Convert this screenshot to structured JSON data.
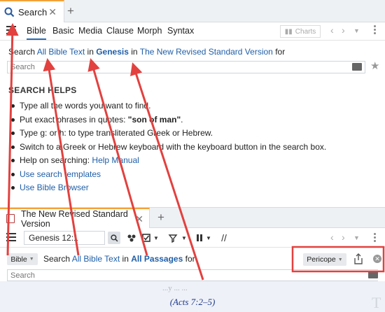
{
  "tabs": {
    "top": {
      "label": "Search",
      "icon": "search-icon",
      "close": "✕",
      "add": "+"
    },
    "bottom": {
      "label": "The New Revised Standard Version",
      "icon": "book-icon",
      "close": "✕",
      "add": "+"
    }
  },
  "menu": {
    "items": [
      "Bible",
      "Basic",
      "Media",
      "Clause",
      "Morph",
      "Syntax"
    ],
    "active": "Bible",
    "charts_label": "Charts"
  },
  "search": {
    "prefix": "Search",
    "scope": "All Bible Text",
    "in_word": "in",
    "book": "Genesis",
    "in_word2": "in",
    "version": "The New Revised Standard Version",
    "suffix": "for",
    "placeholder": "Search"
  },
  "helps": {
    "title": "SEARCH HELPS",
    "items": [
      {
        "text": "Type all the words you want to find."
      },
      {
        "text_a": "Put exact phrases in quotes: ",
        "bold": "\"son of man\"",
        "text_b": "."
      },
      {
        "text": "Type g: or h: to type transliterated Greek or Hebrew."
      },
      {
        "text": "Switch to a Greek or Hebrew keyboard with the keyboard button in the search box."
      },
      {
        "text_a": "Help on searching: ",
        "link": "Help Manual"
      },
      {
        "link": "Use search templates"
      },
      {
        "link": "Use Bible Browser"
      }
    ]
  },
  "bible_panel": {
    "reference": "Genesis 12:1",
    "search_prefix_btn": "Bible",
    "search_prefix": "Search",
    "scope": "All Bible Text",
    "in_word": "in",
    "passages": "All Passages",
    "suffix": "for",
    "pericope": "Pericope",
    "placeholder": "Search",
    "faint_text": "...y ... ...",
    "citation": "(Acts 7:2–5)"
  },
  "colors": {
    "link": "#1f5fa8",
    "accent_tab": "#f2a23a",
    "annotation_red": "#e2413f"
  }
}
